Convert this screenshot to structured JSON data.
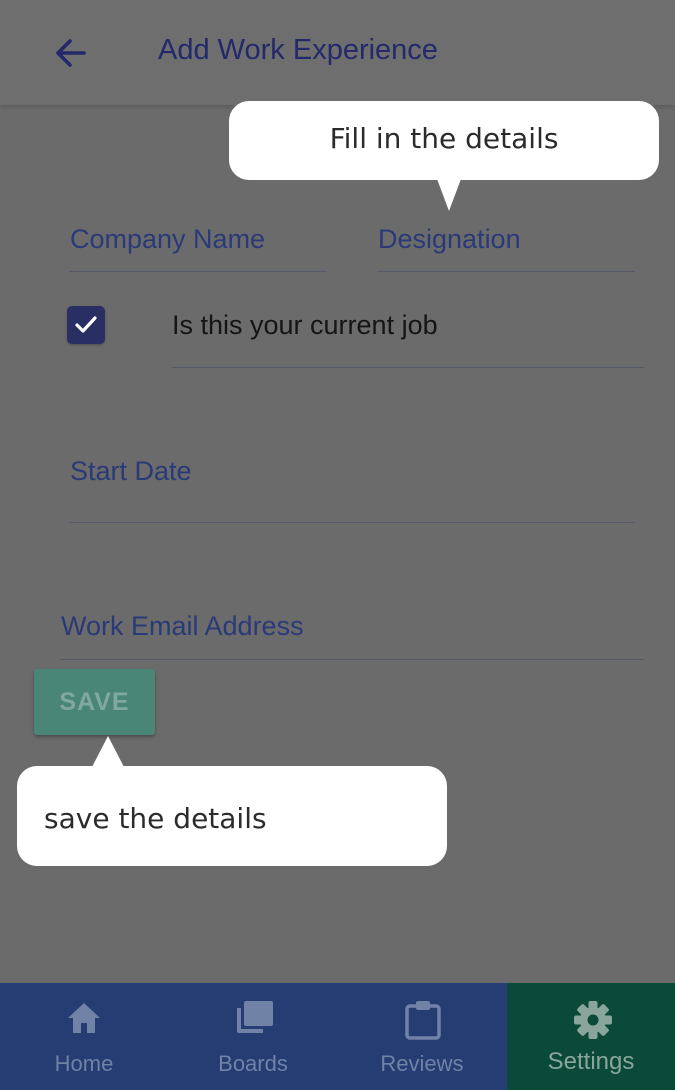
{
  "header": {
    "title": "Add Work Experience",
    "back_icon": "arrow-left-icon"
  },
  "tooltips": {
    "fill_details": "Fill in the details",
    "save_details": "save the details"
  },
  "form": {
    "company_name_label": "Company Name",
    "designation_label": "Designation",
    "current_job_label": "Is this your current job",
    "current_job_checked": true,
    "start_date_label": "Start Date",
    "work_email_label": "Work Email Address",
    "save_label": "SAVE"
  },
  "bottom_nav": {
    "items": [
      {
        "label": "Home",
        "icon": "home-icon"
      },
      {
        "label": "Boards",
        "icon": "boards-icon"
      },
      {
        "label": "Reviews",
        "icon": "clipboard-icon"
      },
      {
        "label": "Settings",
        "icon": "gear-icon",
        "active": true
      }
    ]
  },
  "colors": {
    "overlay": "#6b6b6b",
    "title": "#23296a",
    "nav_background": "#253d73",
    "nav_active": "#0b4a38",
    "save_button": "#4a8676",
    "checkbox": "#2a2f63"
  }
}
